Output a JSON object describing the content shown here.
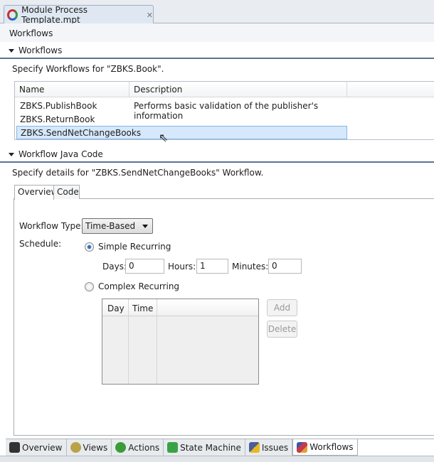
{
  "editor_tab": {
    "title": "Module Process Template.mpt",
    "close_icon": "close-icon"
  },
  "form_title": "Workflows",
  "workflows_section": {
    "title": "Workflows",
    "description": "Specify Workflows for \"ZBKS.Book\".",
    "columns": [
      "Name",
      "Description"
    ],
    "rows": [
      {
        "name": "ZBKS.PublishBook",
        "description": "Performs basic validation of the publisher's information"
      },
      {
        "name": "ZBKS.ReturnBook",
        "description": ""
      },
      {
        "name": "ZBKS.SendNetChangeBooks",
        "description": "",
        "selected": true
      }
    ]
  },
  "java_section": {
    "title": "Workflow Java Code",
    "description": "Specify details for \"ZBKS.SendNetChangeBooks\" Workflow.",
    "tabs": [
      "Overview",
      "Code"
    ],
    "active_tab": "Overview",
    "workflow_type_label": "Workflow Type:",
    "workflow_type_value": "Time-Based",
    "schedule_label": "Schedule:",
    "simple_label": "Simple Recurring",
    "simple_selected": true,
    "days_label": "Days:",
    "days_value": "0",
    "hours_label": "Hours:",
    "hours_value": "1",
    "minutes_label": "Minutes:",
    "minutes_value": "0",
    "complex_label": "Complex Recurring",
    "complex_selected": false,
    "grid_columns": [
      "Day",
      "Time"
    ],
    "add_label": "Add",
    "delete_label": "Delete"
  },
  "bottom_tabs": [
    {
      "label": "Overview",
      "icon": "binoculars-icon"
    },
    {
      "label": "Views",
      "icon": "views-icon"
    },
    {
      "label": "Actions",
      "icon": "actions-icon"
    },
    {
      "label": "State Machine",
      "icon": "chip-icon"
    },
    {
      "label": "Issues",
      "icon": "issues-icon"
    },
    {
      "label": "Workflows",
      "icon": "workflows-icon",
      "active": true
    }
  ],
  "colors": {
    "selection": "#d6e8fb",
    "section_rule": "#5a7490"
  }
}
